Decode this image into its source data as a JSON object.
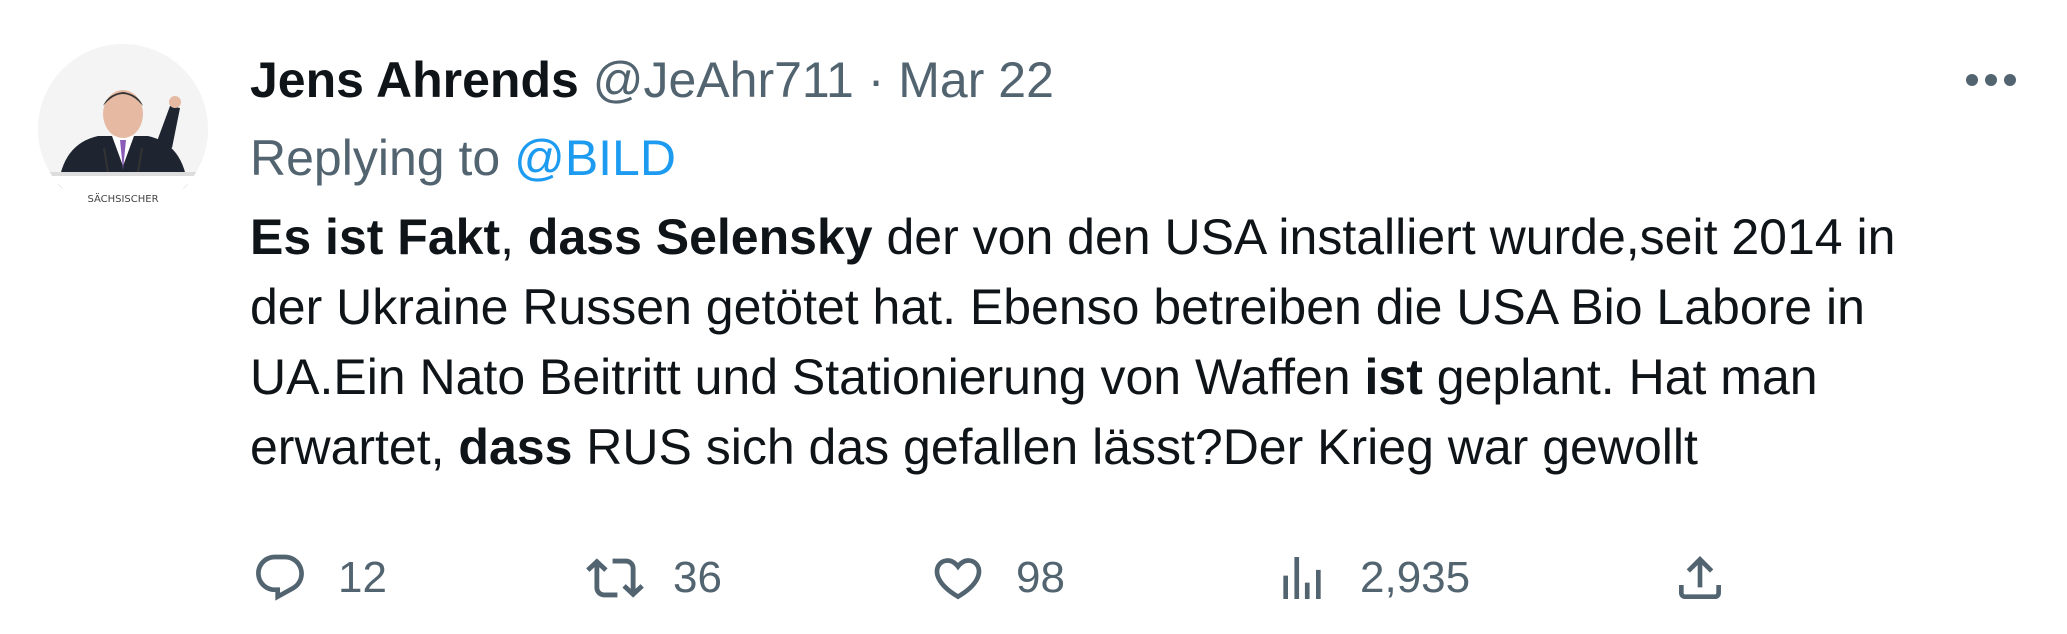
{
  "author": {
    "name": "Jens Ahrends",
    "handle": "@JeAhr711",
    "separator": "·",
    "date": "Mar 22",
    "avatar_banner_text": "SÄCHSISCHER"
  },
  "reply": {
    "prefix": "Replying to",
    "mention": "@BILD"
  },
  "body": {
    "lines": [
      [
        {
          "text": "Es ist Fakt",
          "bold": true
        },
        {
          "text": ", ",
          "bold": false
        },
        {
          "text": "dass Selensky",
          "bold": true
        },
        {
          "text": " der von den USA installiert wurde,seit 2014 in",
          "bold": false
        }
      ],
      [
        {
          "text": "der Ukraine Russen getötet hat. Ebenso betreiben die USA Bio Labore in",
          "bold": false
        }
      ],
      [
        {
          "text": "UA.Ein Nato Beitritt und Stationierung von Waffen ",
          "bold": false
        },
        {
          "text": "ist",
          "bold": true
        },
        {
          "text": " geplant. Hat man",
          "bold": false
        }
      ],
      [
        {
          "text": "erwartet, ",
          "bold": false
        },
        {
          "text": "dass",
          "bold": true
        },
        {
          "text": " RUS sich das gefallen lässt?Der Krieg war gewollt",
          "bold": false
        }
      ]
    ]
  },
  "actions": {
    "reply_count": "12",
    "retweet_count": "36",
    "like_count": "98",
    "views_count": "2,935"
  },
  "icons": {
    "more": "more-horizontal-icon",
    "reply": "reply-bubble-icon",
    "retweet": "retweet-icon",
    "like": "heart-icon",
    "views": "views-bar-chart-icon",
    "share": "share-upload-icon"
  },
  "colors": {
    "text": "#0f1419",
    "muted": "#536471",
    "link": "#1d9bf0",
    "background": "#ffffff"
  }
}
